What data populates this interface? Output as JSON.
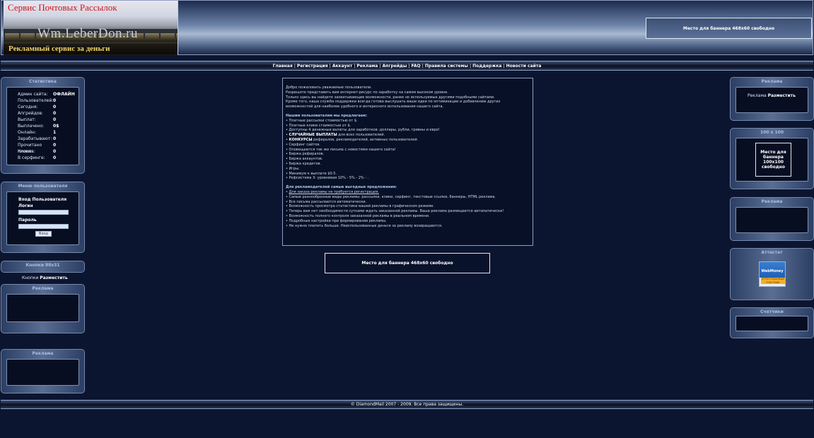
{
  "header": {
    "logo_title": "Сервис Почтовых Рассылок",
    "logo_site": "Wm.LeberDon.ru",
    "logo_slogan": "Рекламный сервис за деньги",
    "top_banner": "Место для баннера 468x60 свободно"
  },
  "nav": {
    "items": [
      "Главная",
      "Регистрация",
      "Аккаунт",
      "Реклама",
      "Апгрейды",
      "FAQ",
      "Правила системы",
      "Поддержка",
      "Новости сайта"
    ],
    "separator": "|"
  },
  "left": {
    "stats": {
      "title": "Статистика",
      "rows": [
        {
          "label": "Админ сайта:",
          "value": "ОФЛАЙН"
        },
        {
          "label": "Пользователей:",
          "value": "0"
        },
        {
          "label": "Сегодня:",
          "value": "0"
        },
        {
          "label": "Апгрейдов:",
          "value": "0"
        },
        {
          "label": "Выплат:",
          "value": "0"
        },
        {
          "label": "Выплачено:",
          "value": "0$"
        },
        {
          "label": "Онлайн:",
          "value": "1"
        },
        {
          "label": "Зарабатывают:",
          "value": "0"
        },
        {
          "label": "Прочитано писем:",
          "value": "0"
        },
        {
          "label": "Кликов:",
          "value": "0"
        },
        {
          "label": "В серфинге:",
          "value": "0"
        }
      ]
    },
    "user_menu": {
      "title": "Меню пользователя",
      "heading": "Вход Пользователя",
      "login_label": "Логин",
      "login_value": "",
      "password_label": "Пароль",
      "password_value": "",
      "submit": "Вход"
    },
    "buttons88": {
      "title": "Кнопки 88x31",
      "prefix": "Кнопки",
      "link": "Разместить"
    },
    "ad1_title": "Реклама",
    "ad2_title": "Реклама"
  },
  "content": {
    "intro": [
      "Добро пожаловать уважаемые пользователи.",
      "Разрешите представить вам интернет-ресурс по заработку на самом высоком уровне.",
      "Только здесь вы найдете захватывающие возможности, ранее не используемые другими подобными сайтами.",
      "Кроме того, наша служба поддержки всегда готова выслушать ваши идеи по оптимизации и добавлению других возможностей для наиболее удобного и интересного использования нашего сайта."
    ],
    "users_heading": "Нашим пользователям мы предлагаем:",
    "users_items": [
      "• Платные рассылки стоимостью от $.",
      "• Платные клики стоимостью от $.",
      "• Доступны 4 денежные валюты для заработков: доллары, рубли, гривны и евро!"
    ],
    "random_bold": "СЛУЧАЙНЫЕ ВЫПЛАТЫ",
    "random_rest": " для всех пользователей.",
    "contests_bold": "КОНКУРСЫ",
    "contests_rest": " рефералов, рекламодателей, активных пользователей.",
    "users_items2": [
      "• Серфинг сайтов.",
      "• Оповещаются так же письма с новостями нашего сайта!",
      "• Биржа рефералов.",
      "• Биржа аккаунтов.",
      "• Биржа кредитов.",
      "• Игры.",
      "• Минимум к выплате $0.5.",
      "• Рефсистема 3- уровневая 10% - 5% - 2% - ."
    ],
    "adv_heading": "Для рекламодателей самые выгодные предложения:",
    "adv_first": "Для заказа рекламы не требуется регистрация.",
    "adv_items": [
      "• Самые разнообразные виды рекламы: рассылки, клики, серфинг, текстовые ссылки, баннеры, HTML реклама.",
      "• Все письма рассылаются автоматически.",
      "• Возможность просмотра статистики вашей рекламы в графическом режиме.",
      "• Теперь вам нет необходимости сутками ждать заказанной рекламы. Ваша реклама размещается автоматически!",
      "• Возможность полного контроля заказанной рекламы в реальном времени.",
      "• Подробные настройки при формировании рекламы.",
      "• Не нужно платить больше. Неиспользованные деньги за рекламу возвращаются."
    ]
  },
  "mid_banner": "Место для баннера 468x60 свободно",
  "right": {
    "ad_title": "Реклама",
    "ad_prefix": "Реклама",
    "ad_link": "Разместить",
    "b100_title": "100 x 100",
    "b100_text": "Место для баннера 100x100 свободно",
    "ad2_title": "Реклама",
    "attest_title": "Аттестат",
    "attest_badge_top": "WebMoney",
    "attest_badge_bottom": "АТТЕСТОВАННЫЙ УЧАСТНИК",
    "counters_title": "Счетчики"
  },
  "footer": "© DiamondMail 2007 - 2009. Все права защищены."
}
